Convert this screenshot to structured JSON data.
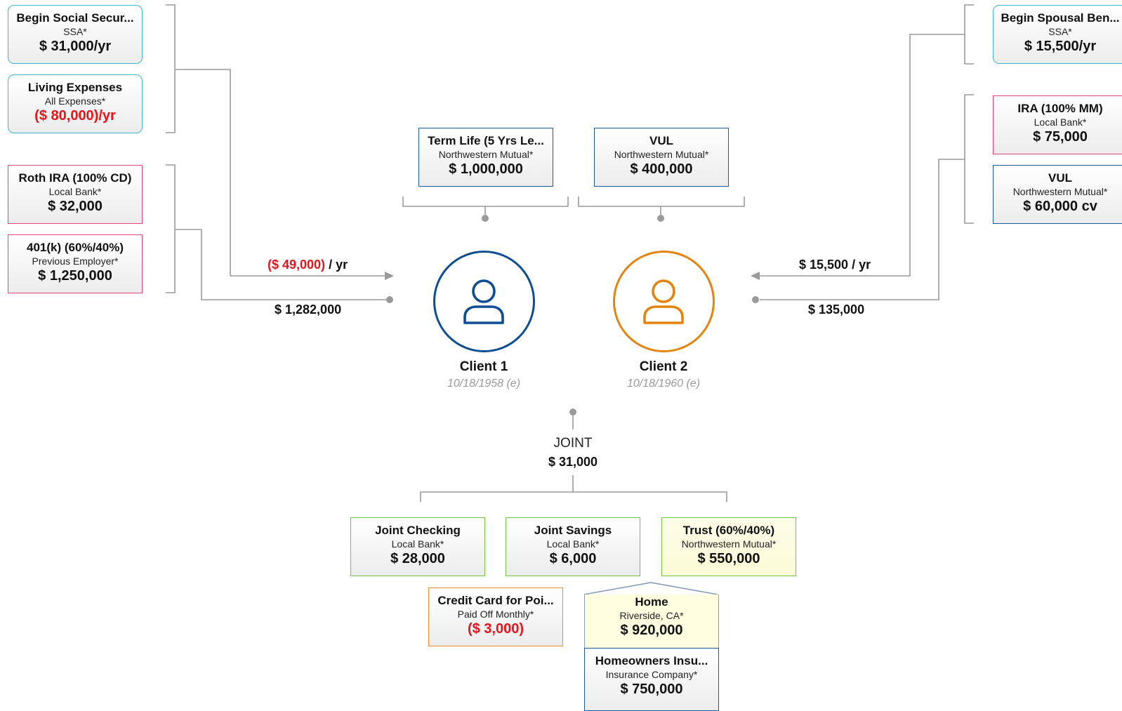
{
  "colors": {
    "client1": "#0d4d92",
    "client2": "#e38410",
    "negative": "#e8141b",
    "line": "#9a9a9a"
  },
  "left_income": [
    {
      "title": "Begin Social Secur...",
      "sub": "SSA*",
      "value": "$ 31,000/yr",
      "negative": false
    },
    {
      "title": "Living Expenses",
      "sub": "All Expenses*",
      "value": "($ 80,000)/yr",
      "negative": true
    }
  ],
  "left_assets": [
    {
      "title": "Roth IRA (100% CD)",
      "sub": "Local Bank*",
      "value": "$ 32,000"
    },
    {
      "title": "401(k) (60%/40%)",
      "sub": "Previous Employer*",
      "value": "$ 1,250,000"
    }
  ],
  "right_income": [
    {
      "title": "Begin Spousal Ben...",
      "sub": "SSA*",
      "value": "$ 15,500/yr"
    }
  ],
  "right_assets": [
    {
      "title": "IRA (100% MM)",
      "sub": "Local Bank*",
      "value": "$ 75,000"
    },
    {
      "title": "VUL",
      "sub": "Northwestern Mutual*",
      "value": "$ 60,000 cv"
    }
  ],
  "insurance": {
    "client1": {
      "title": "Term Life (5 Yrs Le...",
      "sub": "Northwestern Mutual*",
      "value": "$ 1,000,000"
    },
    "client2": {
      "title": "VUL",
      "sub": "Northwestern Mutual*",
      "value": "$ 400,000"
    }
  },
  "flows": {
    "client1_income_neg": "($ 49,000)",
    "client1_income_suffix": " / yr",
    "client1_assets": "$ 1,282,000",
    "client2_income": "$ 15,500 / yr",
    "client2_assets": "$ 135,000"
  },
  "clients": [
    {
      "name": "Client 1",
      "dob": "10/18/1958 (e)",
      "icon": "person-icon"
    },
    {
      "name": "Client 2",
      "dob": "10/18/1960 (e)",
      "icon": "person-icon"
    }
  ],
  "joint": {
    "label": "JOINT",
    "value": "$ 31,000",
    "accounts": [
      {
        "title": "Joint Checking",
        "sub": "Local Bank*",
        "value": "$ 28,000"
      },
      {
        "title": "Joint Savings",
        "sub": "Local Bank*",
        "value": "$ 6,000"
      },
      {
        "title": "Trust (60%/40%)",
        "sub": "Northwestern Mutual*",
        "value": "$ 550,000"
      }
    ],
    "credit_card": {
      "title": "Credit Card for Poi...",
      "sub": "Paid Off Monthly*",
      "value": "($ 3,000)"
    },
    "home": {
      "title": "Home",
      "sub": "Riverside, CA*",
      "value": "$ 920,000"
    },
    "home_insurance": {
      "title": "Homeowners Insu...",
      "sub": "Insurance Company*",
      "value": "$ 750,000"
    }
  }
}
